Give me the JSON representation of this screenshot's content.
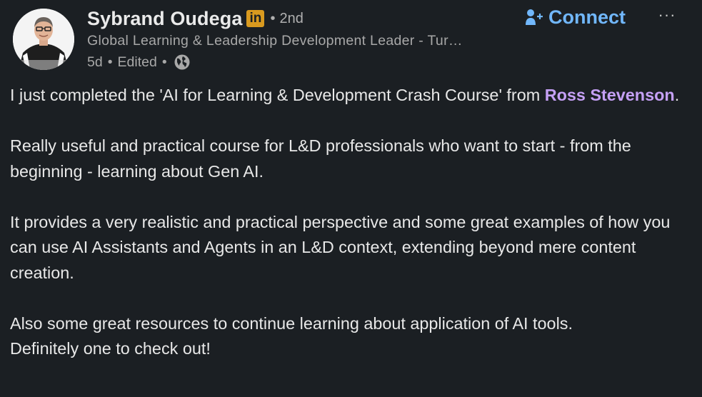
{
  "author": {
    "name": "Sybrand Oudega",
    "badge": "in",
    "bullet": "•",
    "degree": "2nd",
    "headline": "Global Learning & Leadership Development Leader - Tur…",
    "time": "5d",
    "edited": "Edited",
    "visibility_icon": "globe-icon"
  },
  "actions": {
    "connect_label": "Connect",
    "connect_icon": "add-person-icon",
    "more_label": "···",
    "more_icon": "ellipsis-icon"
  },
  "post": {
    "p1_before": "I just completed the 'AI for Learning & Development Crash Course' from ",
    "p1_mention": "Ross Stevenson",
    "p1_after": ".",
    "p2": "Really useful and practical course for L&D professionals who want to start - from the beginning - learning about Gen AI.",
    "p3": "It provides a very realistic and practical perspective and some great examples of how you can use AI Assistants and Agents in an L&D context, extending beyond mere content creation.",
    "p4_line1": "Also some great resources to continue learning about application of AI tools.",
    "p4_line2": "Definitely one to check out!"
  },
  "colors": {
    "background": "#1b1f23",
    "accent_connect": "#71b7fb",
    "mention": "#c5a0f5",
    "badge": "#d99a1f"
  }
}
